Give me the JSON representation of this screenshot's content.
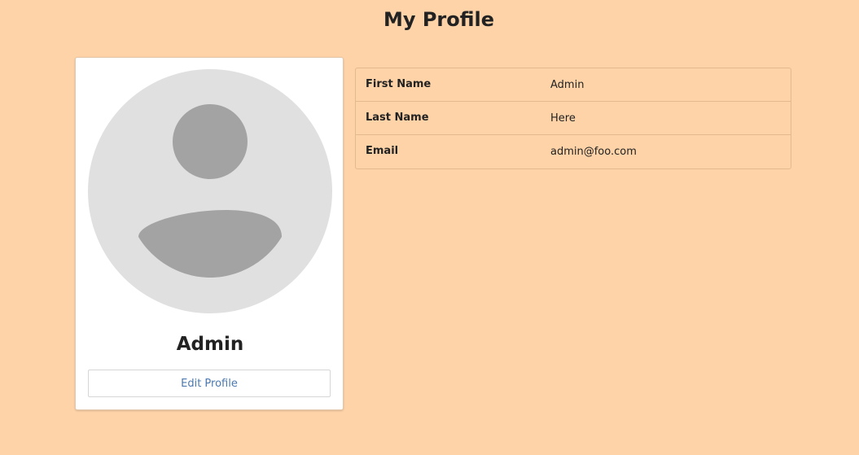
{
  "page": {
    "title": "My Profile",
    "background_color": "#fed3a8"
  },
  "profile_card": {
    "avatar_icon": "user-avatar-placeholder-icon",
    "name": "Admin",
    "edit_button_label": "Edit Profile",
    "link_color": "#4a78b0"
  },
  "details": {
    "rows": [
      {
        "label": "First Name",
        "value": "Admin"
      },
      {
        "label": "Last Name",
        "value": "Here"
      },
      {
        "label": "Email",
        "value": "admin@foo.com"
      }
    ]
  }
}
